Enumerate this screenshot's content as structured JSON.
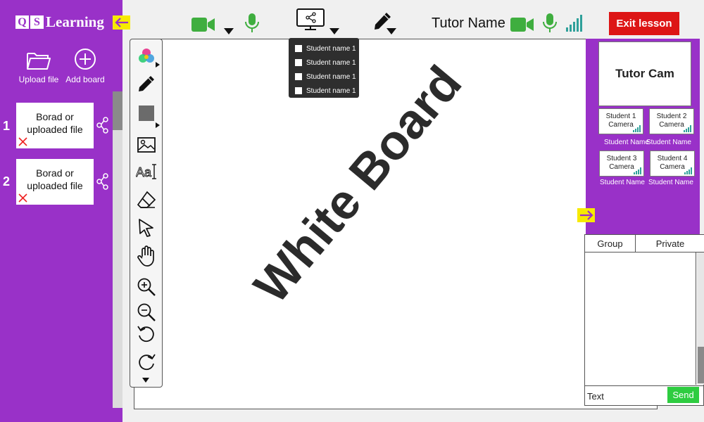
{
  "brand": {
    "letters": [
      "Q",
      "S"
    ],
    "word": "Learning"
  },
  "colors": {
    "sidebar": "#9931c8",
    "accent_yellow": "#f7ea00",
    "exit_red": "#dd1515",
    "media_green": "#3fae3f",
    "send_green": "#2ecc40"
  },
  "sidebar": {
    "collapse_icon": "arrow-left-icon",
    "actions": [
      {
        "label": "Upload file",
        "icon": "folder-open-icon"
      },
      {
        "label": "Add board",
        "icon": "plus-circle-icon"
      }
    ],
    "boards": [
      {
        "number": "1",
        "text_line1": "Borad or",
        "text_line2": "uploaded file"
      },
      {
        "number": "2",
        "text_line1": "Borad or",
        "text_line2": "uploaded file"
      }
    ]
  },
  "topbar": {
    "tutor_name": "Tutor Name",
    "exit_label": "Exit lesson",
    "icons": [
      "video-camera-icon",
      "microphone-icon",
      "screen-share-icon",
      "pen-icon",
      "signal-bars-icon"
    ]
  },
  "share_dropdown": {
    "items": [
      "Student name 1",
      "Student name 1",
      "Student name 1",
      "Student name 1"
    ]
  },
  "whiteboard": {
    "label": "White Board"
  },
  "toolbar": {
    "tools": [
      "color-palette-icon",
      "pencil-icon",
      "shape-icon",
      "image-icon",
      "text-icon",
      "eraser-icon",
      "pointer-icon",
      "hand-icon",
      "zoom-in-icon",
      "zoom-out-icon",
      "undo-icon",
      "redo-icon",
      "more-down-icon"
    ]
  },
  "cameras": {
    "tutor_cam": "Tutor Cam",
    "students": [
      {
        "line1": "Student 1",
        "line2": "Camera",
        "name": "Student Name"
      },
      {
        "line1": "Student 2",
        "line2": "Camera",
        "name": "Student Name"
      },
      {
        "line1": "Student 3",
        "line2": "Camera",
        "name": "Student Name"
      },
      {
        "line1": "Student 4",
        "line2": "Camera",
        "name": "Student Name"
      }
    ]
  },
  "chat": {
    "tabs": [
      "Group",
      "Private"
    ],
    "input_value": "Text",
    "send_label": "Send"
  }
}
